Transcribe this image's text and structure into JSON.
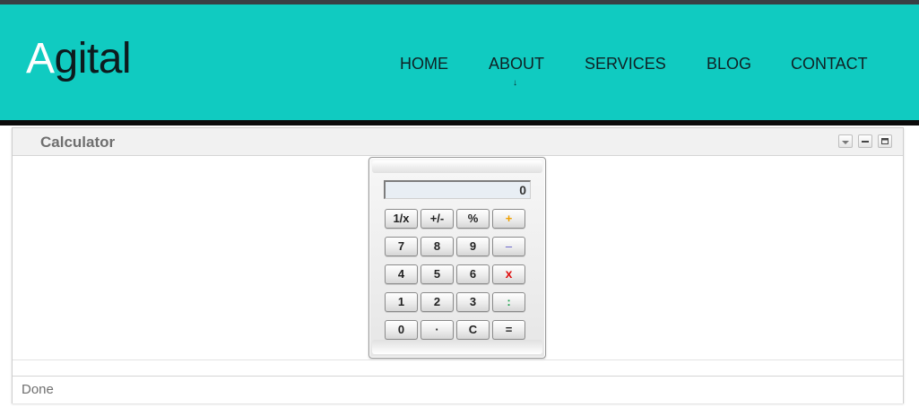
{
  "brand": {
    "first_letter": "A",
    "rest": "gital"
  },
  "nav": {
    "home": "HOME",
    "about": "ABOUT",
    "services": "SERVICES",
    "blog": "BLOG",
    "contact": "CONTACT",
    "about_caret": "↓"
  },
  "window": {
    "title": "Calculator",
    "status": "Done"
  },
  "calculator": {
    "display": "0",
    "keys": {
      "reciprocal": "1/x",
      "negate": "+/-",
      "percent": "%",
      "plus": "+",
      "seven": "7",
      "eight": "8",
      "nine": "9",
      "minus": "–",
      "four": "4",
      "five": "5",
      "six": "6",
      "times": "x",
      "one": "1",
      "two": "2",
      "three": "3",
      "divide": ":",
      "zero": "0",
      "decimal": "·",
      "clear": "C",
      "equals": "="
    }
  },
  "colors": {
    "header": "#10cbc1",
    "plus": "#f0a000",
    "minus": "#5b57c8",
    "times": "#e01010",
    "divide": "#19a04a"
  }
}
